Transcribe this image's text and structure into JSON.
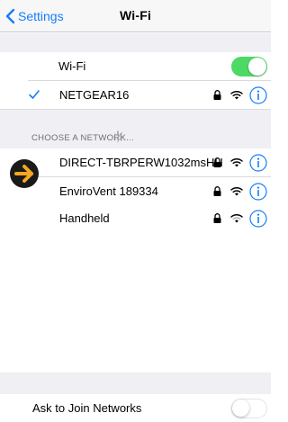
{
  "navbar": {
    "back_label": "Settings",
    "title": "Wi-Fi"
  },
  "wifi_toggle": {
    "label": "Wi-Fi",
    "state": "on"
  },
  "connected_network": {
    "name": "NETGEAR16",
    "secured": true,
    "checked": true
  },
  "networks_section": {
    "header": "CHOOSE A NETWORK...",
    "items": [
      {
        "name": "DIRECT-TBRPERW1032msHH",
        "secured": true
      },
      {
        "name": "EnviroVent 189334",
        "secured": true
      },
      {
        "name": "Handheld",
        "secured": true
      }
    ]
  },
  "ask_to_join": {
    "label": "Ask to Join Networks",
    "state": "off"
  },
  "colors": {
    "accent": "#147efb",
    "toggle_on": "#4cd964",
    "arrow": "#f5a623",
    "group_background": "#efeff4"
  },
  "icons": {
    "back": "chevron-left-icon",
    "check": "checkmark-icon",
    "lock": "lock-icon",
    "wifi": "wifi-signal-icon",
    "info": "info-icon",
    "spinner": "loading-spinner-icon",
    "arrow": "arrow-right-icon"
  }
}
